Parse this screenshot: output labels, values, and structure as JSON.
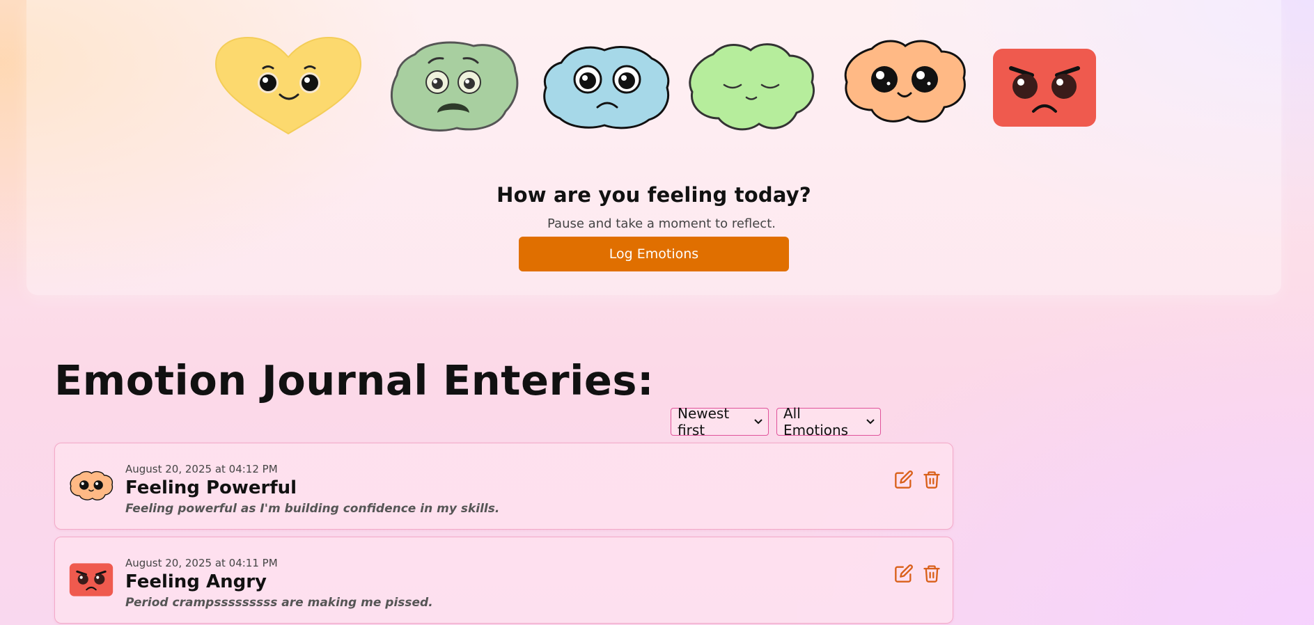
{
  "hero": {
    "faces": [
      {
        "icon": "heart-happy-face-icon",
        "color": "#fcd96e"
      },
      {
        "icon": "blob-anxious-face-icon",
        "color": "#a8cfa0"
      },
      {
        "icon": "cloud-sad-face-icon",
        "color": "#a6d8e8"
      },
      {
        "icon": "flower-calm-face-icon",
        "color": "#b6ed9c"
      },
      {
        "icon": "flower-powerful-face-icon",
        "color": "#ffb985"
      },
      {
        "icon": "square-angry-face-icon",
        "color": "#ef5a4e"
      }
    ],
    "title": "How are you feeling today?",
    "subtitle": "Pause and take a moment to reflect.",
    "button_label": "Log Emotions",
    "accent": "#e06f00"
  },
  "journal": {
    "title": "Emotion Journal Enteries:",
    "sort": {
      "selected": "Newest first"
    },
    "filter": {
      "selected": "All Emotions"
    },
    "entries": [
      {
        "icon": "flower-powerful-face-icon",
        "date": "August 20, 2025 at 04:12 PM",
        "title": "Feeling Powerful",
        "note": "Feeling powerful as I'm building confidence in my skills."
      },
      {
        "icon": "square-angry-face-icon",
        "date": "August 20, 2025 at 04:11 PM",
        "title": "Feeling Angry",
        "note": "Period crampsssssssss are making me pissed."
      }
    ]
  }
}
